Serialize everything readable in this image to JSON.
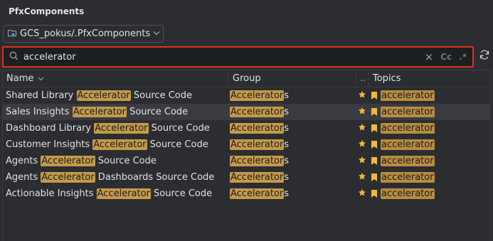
{
  "panel": {
    "title": "PfxComponents"
  },
  "repo": {
    "label": "GCS_pokus/.PfxComponents"
  },
  "search": {
    "value": "accelerator",
    "case_label": "Cc",
    "regex_label": ".*",
    "clear_label": "×"
  },
  "table": {
    "columns": {
      "name": "Name",
      "group": "Group",
      "dots": "..",
      "topics": "Topics"
    },
    "rows": [
      {
        "pre": "Shared Library ",
        "match": "Accelerator",
        "post": " Source Code",
        "group_match": "Accelerator",
        "group_post": "s",
        "topic": "accelerator"
      },
      {
        "pre": "Sales Insights ",
        "match": "Accelerator",
        "post": " Source Code",
        "group_match": "Accelerator",
        "group_post": "s",
        "topic": "accelerator"
      },
      {
        "pre": "Dashboard Library ",
        "match": "Accelerator",
        "post": " Source Code",
        "group_match": "Accelerator",
        "group_post": "s",
        "topic": "accelerator"
      },
      {
        "pre": "Customer Insights ",
        "match": "Accelerator",
        "post": " Source Code",
        "group_match": "Accelerator",
        "group_post": "s",
        "topic": "accelerator"
      },
      {
        "pre": "Agents ",
        "match": "Accelerator",
        "post": " Source Code",
        "group_match": "Accelerator",
        "group_post": "s",
        "topic": "accelerator"
      },
      {
        "pre": "Agents ",
        "match": "Accelerator",
        "post": " Dashboards Source Code",
        "group_match": "Accelerator",
        "group_post": "s",
        "topic": "accelerator"
      },
      {
        "pre": "Actionable Insights ",
        "match": "Accelerator",
        "post": " Source Code",
        "group_match": "Accelerator",
        "group_post": "s",
        "topic": "accelerator"
      }
    ],
    "selected_row": 1
  },
  "colors": {
    "highlight": "#c49a4a",
    "star": "#f0b83b",
    "search_border": "#e0301e"
  },
  "icons": {
    "repo": "folder-icon",
    "search": "search-icon",
    "refresh": "refresh-icon",
    "star": "star-icon",
    "bookmark": "bookmark-icon",
    "sort": "chevron-down-icon"
  }
}
